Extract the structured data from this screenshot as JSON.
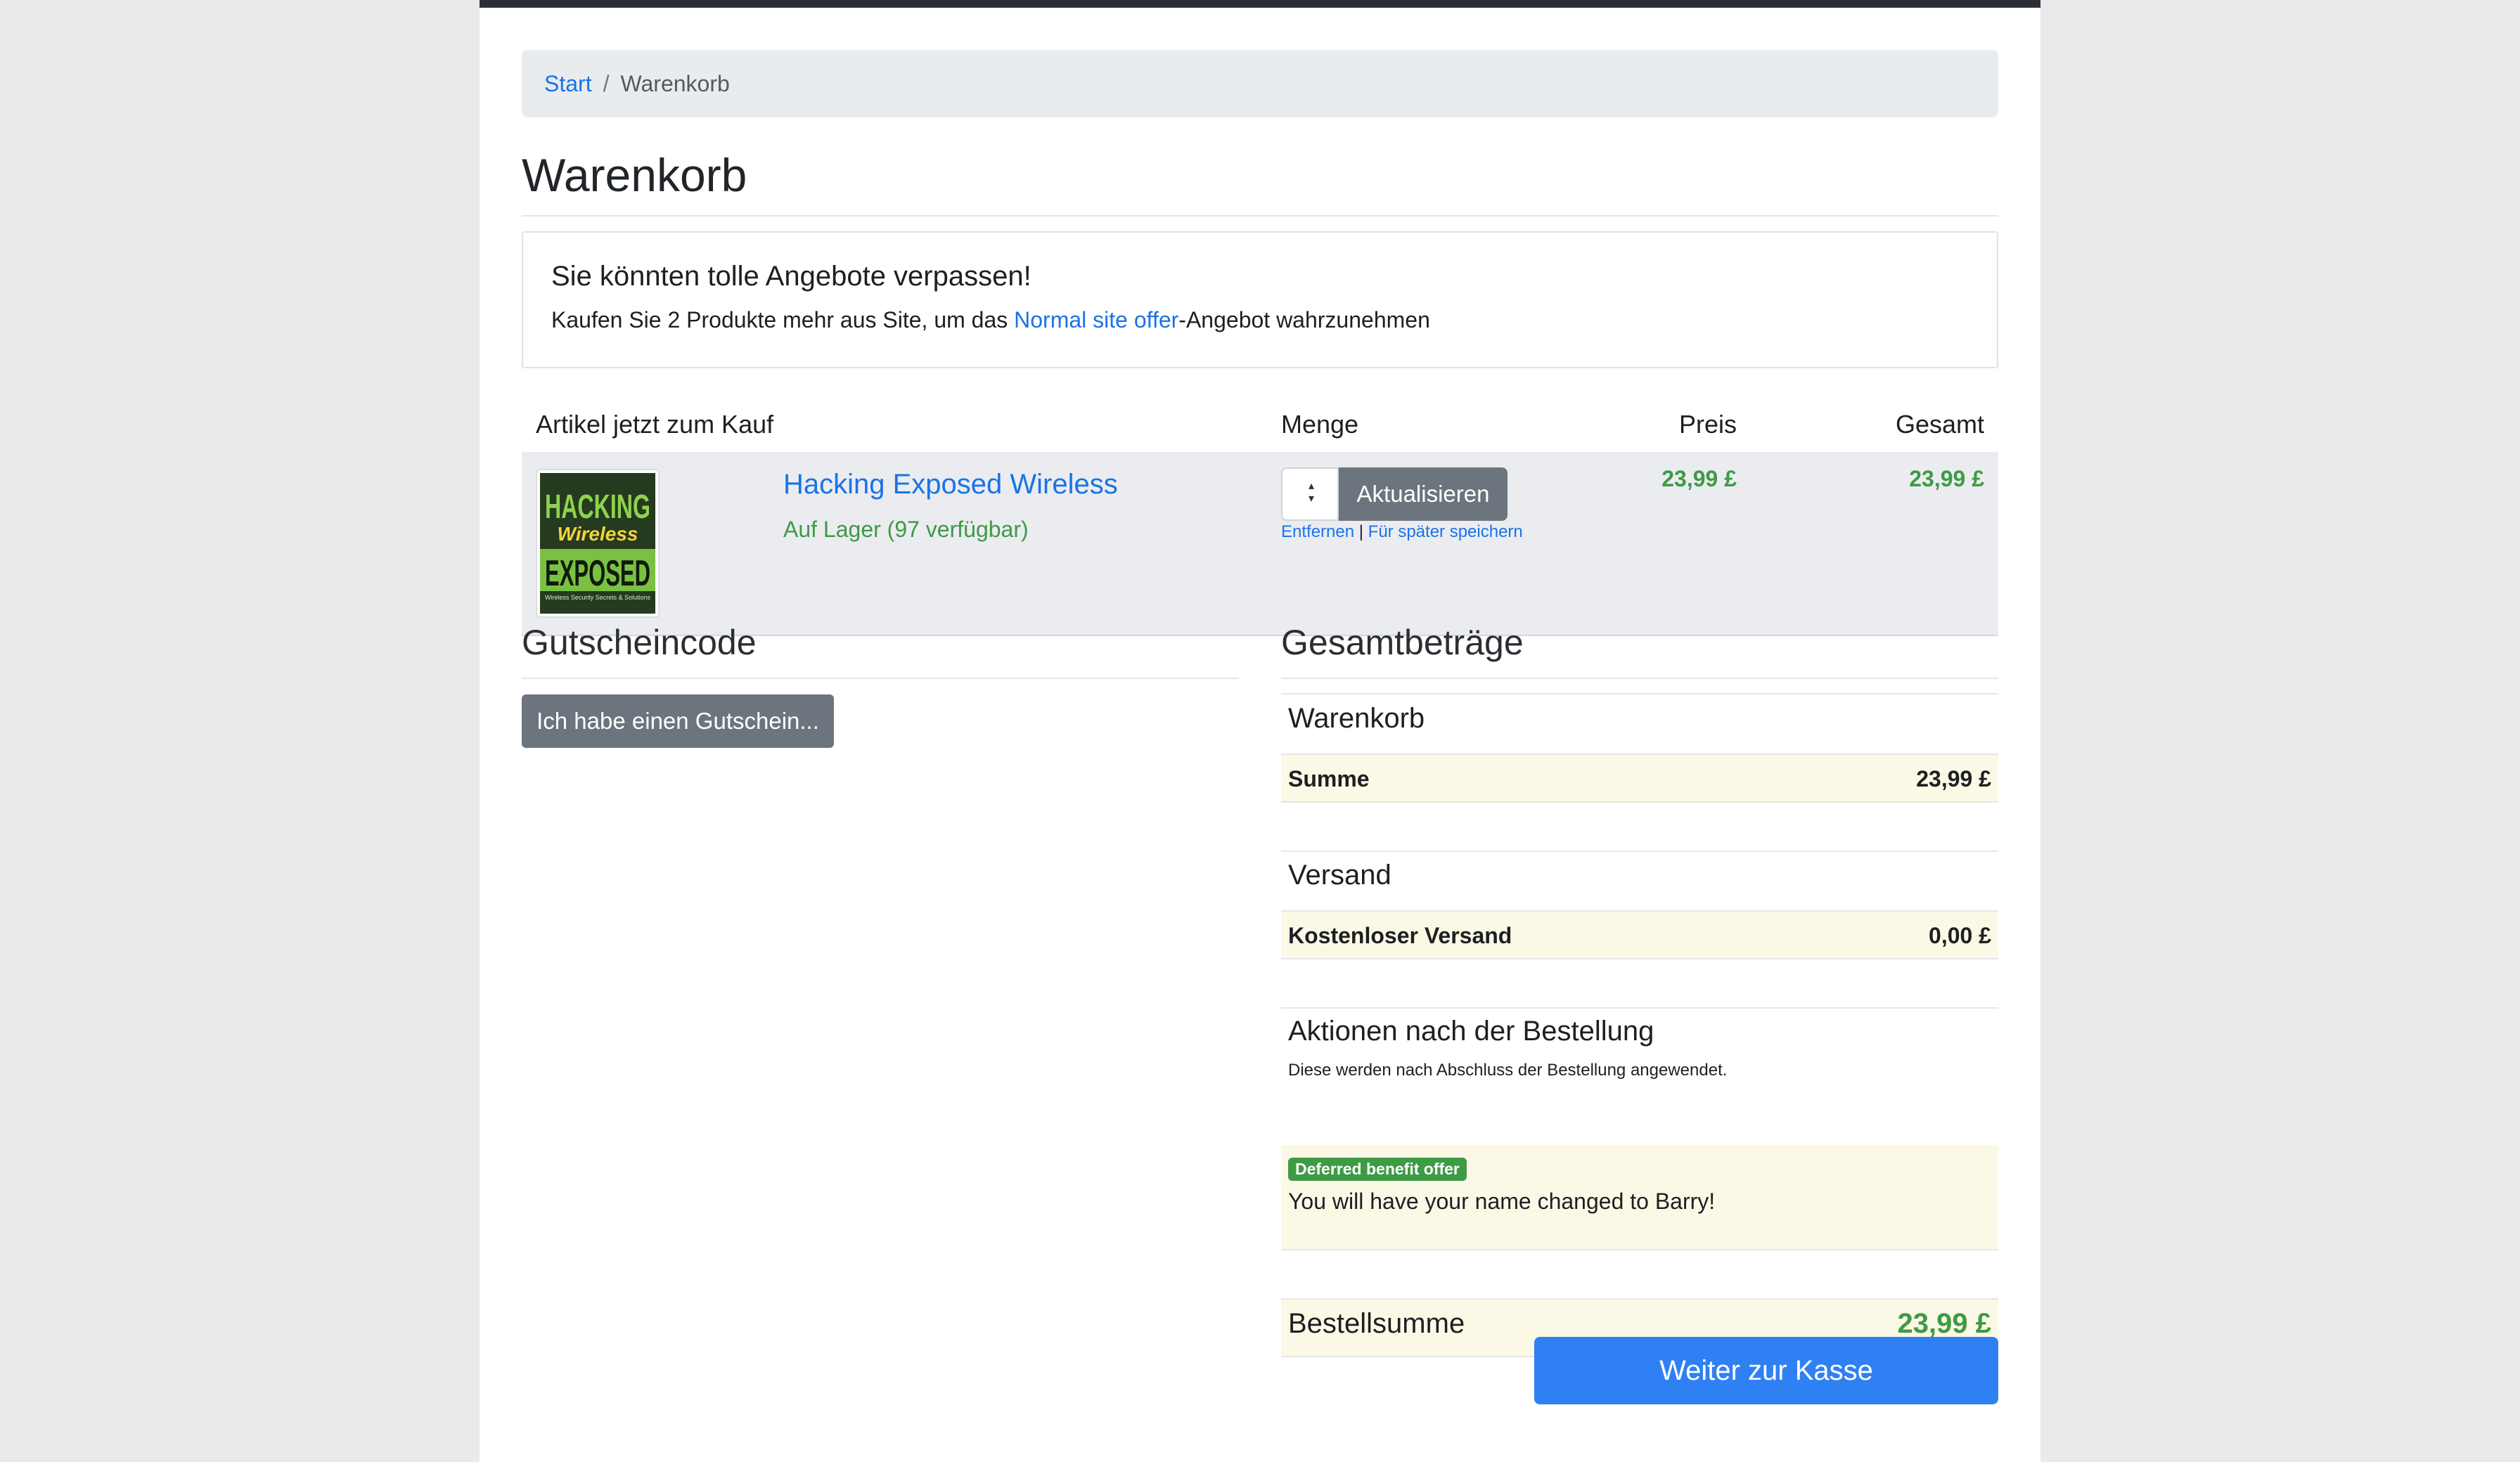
{
  "breadcrumb": {
    "home": "Start",
    "separator": "/",
    "current": "Warenkorb"
  },
  "page_title": "Warenkorb",
  "offer": {
    "title": "Sie könnten tolle Angebote verpassen!",
    "text_before": "Kaufen Sie 2 Produkte mehr aus Site, um das ",
    "link": "Normal site offer",
    "text_after": "-Angebot wahrzunehmen"
  },
  "basket_headers": {
    "item": "Artikel jetzt zum Kauf",
    "qty": "Menge",
    "price": "Preis",
    "total": "Gesamt"
  },
  "basket_items": [
    {
      "name": "Hacking Exposed Wireless",
      "stock": "Auf Lager (97 verfügbar)",
      "cover_text": {
        "line1": "HACKING",
        "line2": "Wireless",
        "line3": "EXPOSED",
        "line4": "Wireless Security Secrets & Solutions"
      },
      "update_label": "Aktualisieren",
      "remove_label": "Entfernen",
      "link_sep": "|",
      "save_label": "Für später speichern",
      "price": "23,99 £",
      "total": "23,99 £"
    }
  ],
  "voucher": {
    "title": "Gutscheincode",
    "button": "Ich habe einen Gutschein..."
  },
  "totals": {
    "title": "Gesamtbeträge",
    "basket_heading": "Warenkorb",
    "subtotal_label": "Summe",
    "subtotal_value": "23,99 £",
    "shipping_heading": "Versand",
    "shipping_label": "Kostenloser Versand",
    "shipping_value": "0,00 £",
    "post_order_heading": "Aktionen nach der Bestellung",
    "post_order_note": "Diese werden nach Abschluss der Bestellung angewendet.",
    "benefit_badge": "Deferred benefit offer",
    "benefit_text": "You will have your name changed to Barry!",
    "order_total_label": "Bestellsumme",
    "order_total_value": "23,99 £"
  },
  "checkout_button": "Weiter zur Kasse",
  "colors": {
    "link": "#1a73e8",
    "success": "#3e9a45",
    "primary": "#2f80f3",
    "secondary": "#6c757d",
    "highlight": "#fbf8e6"
  },
  "icons": [
    "chevron-up-down-icon"
  ]
}
